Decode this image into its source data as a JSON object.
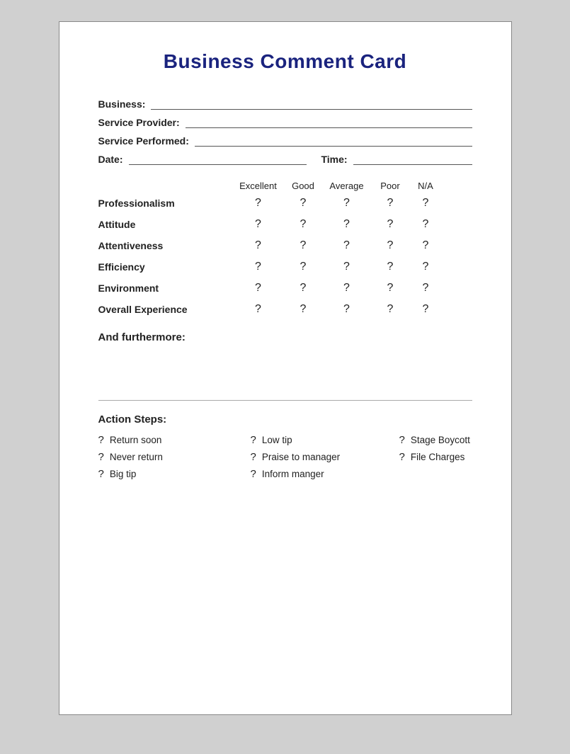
{
  "card": {
    "title": "Business Comment Card",
    "fields": {
      "business_label": "Business:",
      "service_provider_label": "Service Provider:",
      "service_performed_label": "Service Performed:",
      "date_label": "Date:",
      "time_label": "Time:"
    },
    "rating_headers": {
      "excellent": "Excellent",
      "good": "Good",
      "average": "Average",
      "poor": "Poor",
      "na": "N/A"
    },
    "rating_rows": [
      {
        "label": "Professionalism"
      },
      {
        "label": "Attitude"
      },
      {
        "label": "Attentiveness"
      },
      {
        "label": "Efficiency"
      },
      {
        "label": "Environment"
      },
      {
        "label": "Overall Experience"
      }
    ],
    "radio_symbol": "?",
    "furthermore_label": "And furthermore:",
    "action_steps": {
      "title": "Action Steps:",
      "items": [
        [
          {
            "text": "Return soon"
          },
          {
            "text": "Low tip"
          },
          {
            "text": "Stage Boycott"
          }
        ],
        [
          {
            "text": "Never return"
          },
          {
            "text": "Praise to manager"
          },
          {
            "text": "File Charges"
          }
        ],
        [
          {
            "text": "Big tip"
          },
          {
            "text": "Inform manger"
          },
          {
            "text": ""
          }
        ]
      ]
    }
  }
}
